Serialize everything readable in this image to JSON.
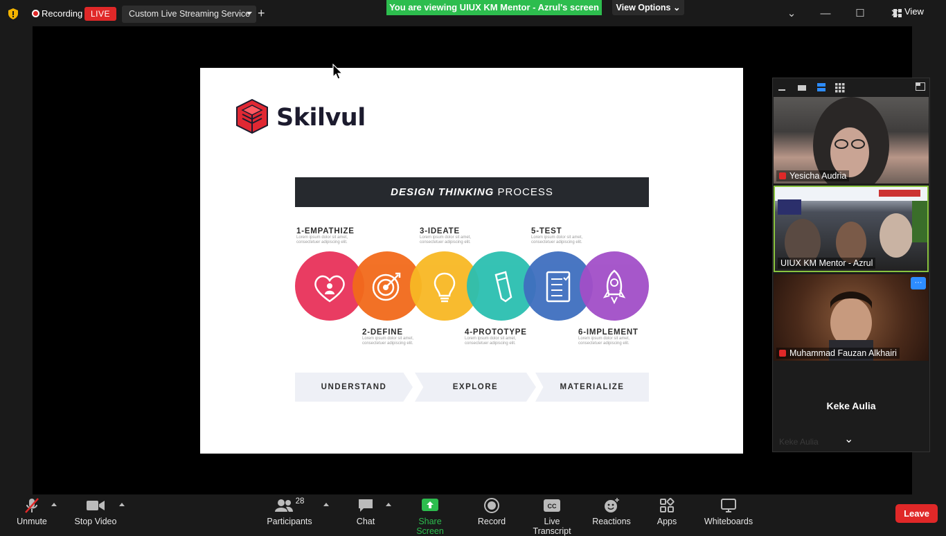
{
  "topbar": {
    "recording_label": "Recording",
    "live_label": "LIVE",
    "stream_service": "Custom Live Streaming Service",
    "plus": "+",
    "viewing_banner": "You are viewing UIUX KM Mentor - Azrul's screen",
    "view_options": "View Options ⌄",
    "window_buttons": {
      "chevron": "⌄",
      "minimize": "—",
      "maximize": "☐",
      "close": "✕"
    },
    "view_label": "View"
  },
  "slide": {
    "logo_text": "Skilvul",
    "header_bold": "DESIGN THINKING",
    "header_rest": " PROCESS",
    "steps_top": [
      {
        "label": "1-EMPATHIZE",
        "sub": "Lorem ipsum dolor sit amet, consectetuer adipiscing elit."
      },
      {
        "label": "3-IDEATE",
        "sub": "Lorem ipsum dolor sit amet, consectetuer adipiscing elit."
      },
      {
        "label": "5-TEST",
        "sub": "Lorem ipsum dolor sit amet, consectetuer adipiscing elit."
      }
    ],
    "steps_bottom": [
      {
        "label": "2-DEFINE",
        "sub": "Lorem ipsum dolor sit amet, consectetuer adipiscing elit."
      },
      {
        "label": "4-PROTOTYPE",
        "sub": "Lorem ipsum dolor sit amet, consectetuer adipiscing elit."
      },
      {
        "label": "6-IMPLEMENT",
        "sub": "Lorem ipsum dolor sit amet, consectetuer adipiscing elit."
      }
    ],
    "circle_colors": [
      "#e8325a",
      "#f26a1b",
      "#f8b824",
      "#2bbfb0",
      "#3f6fbf",
      "#a24fc8"
    ],
    "phases": [
      "UNDERSTAND",
      "EXPLORE",
      "MATERIALIZE"
    ]
  },
  "participants_panel": {
    "tiles": [
      {
        "name": "Yesicha Audria",
        "muted": true
      },
      {
        "name": "UIUX KM Mentor - Azrul",
        "muted": false
      },
      {
        "name": "Muhammad Fauzan Alkhairi",
        "muted": true
      }
    ],
    "no_video_name": "Keke Aulia",
    "no_video_footer": "Keke Aulia",
    "more_button": "···",
    "scroll_down": "⌄"
  },
  "toolbar": {
    "unmute": "Unmute",
    "stop_video": "Stop Video",
    "participants": "Participants",
    "participants_count": "28",
    "chat": "Chat",
    "share_screen": "Share Screen",
    "record": "Record",
    "live_transcript": "Live Transcript",
    "reactions": "Reactions",
    "apps": "Apps",
    "whiteboards": "Whiteboards",
    "leave": "Leave"
  },
  "colors": {
    "banner_green": "#2dbd4e",
    "leave_red": "#e02828",
    "live_red": "#e02828",
    "active_tile_border": "#8ac43f",
    "share_green": "#2dbd4e"
  }
}
